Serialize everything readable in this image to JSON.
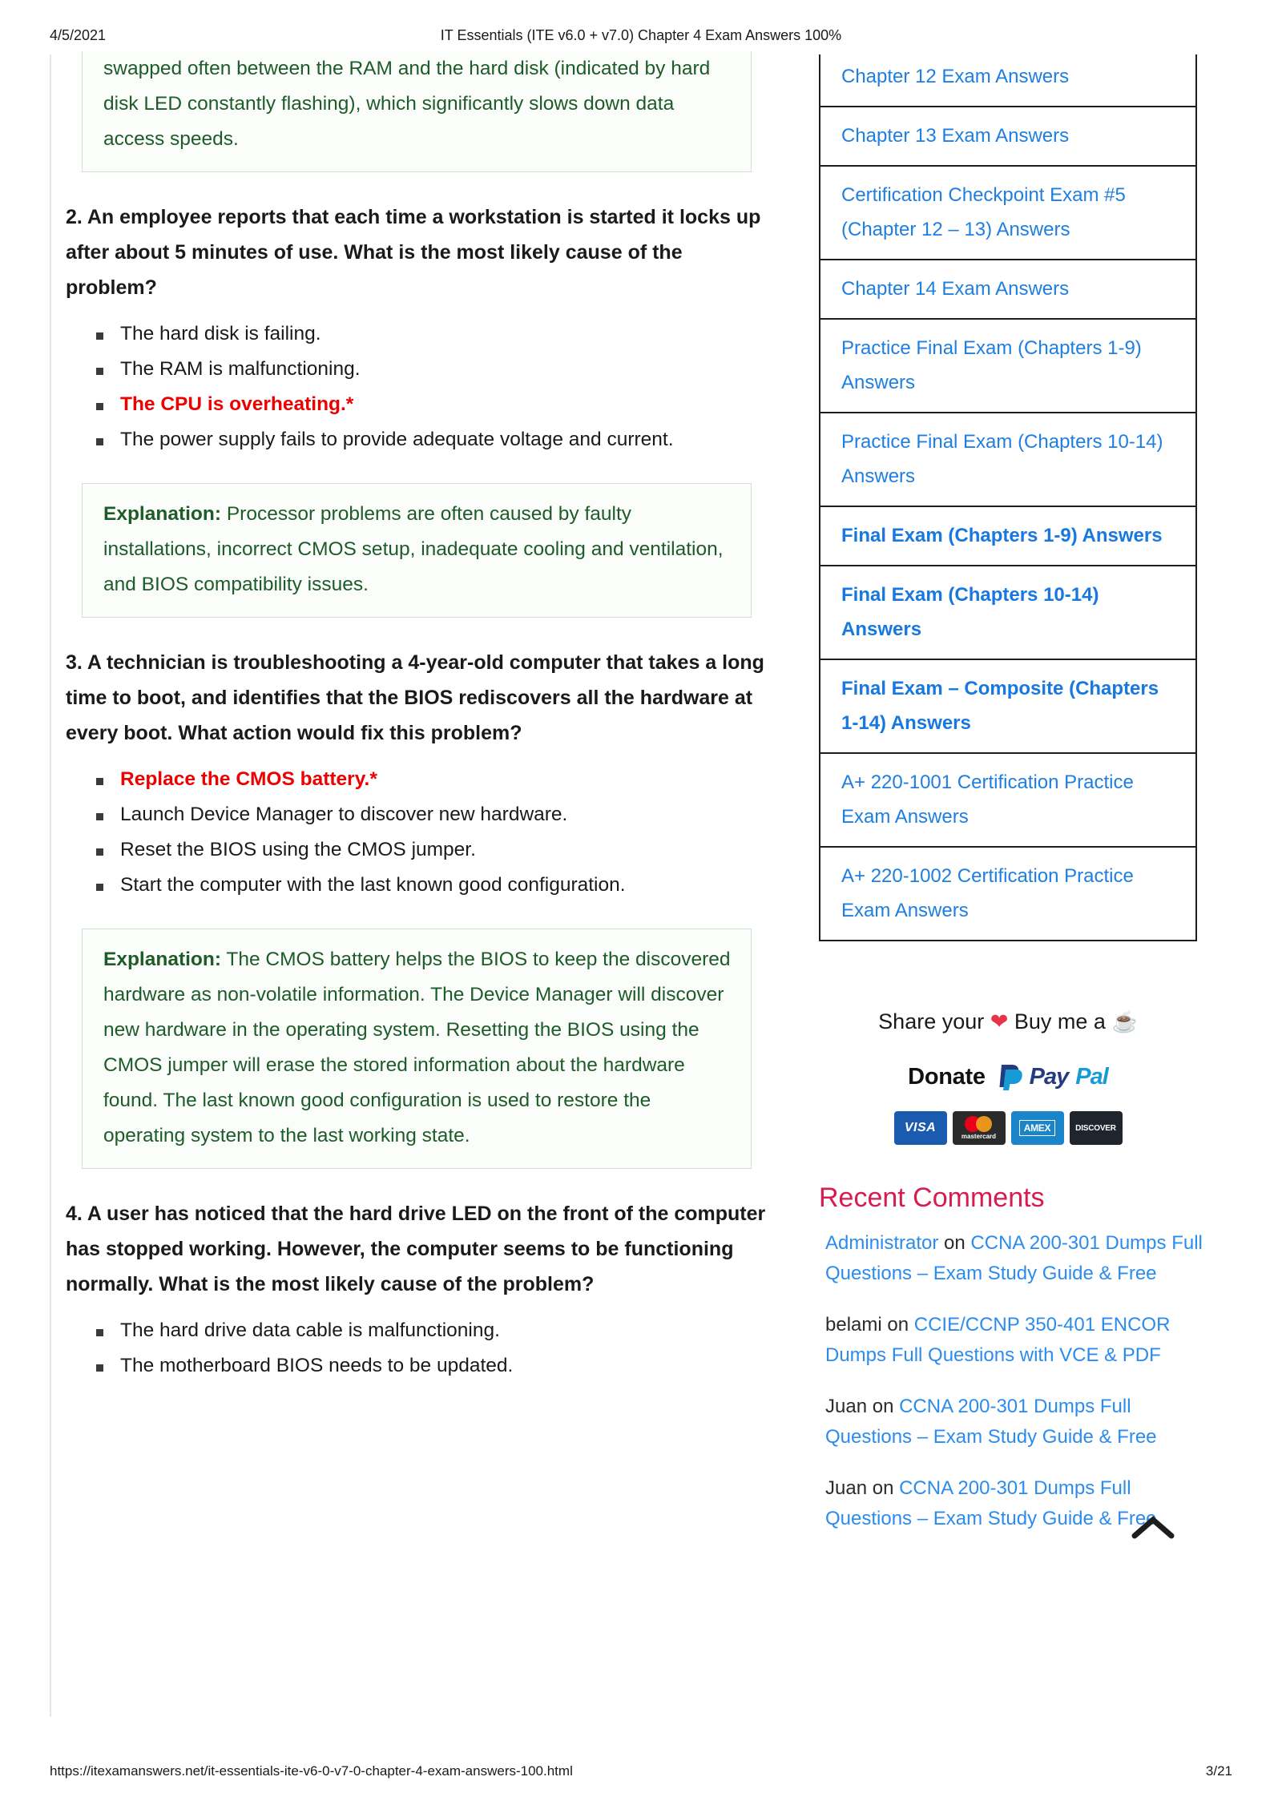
{
  "print": {
    "date": "4/5/2021",
    "title": "IT Essentials (ITE v6.0 + v7.0) Chapter 4 Exam Answers 100%",
    "url": "https://itexamanswers.net/it-essentials-ite-v6-0-v7-0-chapter-4-exam-answers-100.html",
    "page": "3/21"
  },
  "colors": {
    "link": "#2b8ced",
    "correct": "#ee0000",
    "explanation": "#1d5c28",
    "heading_pink": "#d81b50"
  },
  "article": {
    "explanation_top": {
      "text": "swapped often between the RAM and the hard disk (indicated by hard disk LED constantly flashing), which significantly slows down data access speeds."
    },
    "questions": [
      {
        "number": "2",
        "text": "2. An employee reports that each time a workstation is started it locks up after about 5 minutes of use. What is the most likely cause of the problem?",
        "choices": [
          "The hard disk is failing.",
          "The RAM is malfunctioning.",
          "The CPU is overheating.*",
          "The power supply fails to provide adequate voltage and current."
        ],
        "correct_index": 2,
        "explanation_label": "Explanation:",
        "explanation_text": " Processor problems are often caused by faulty installations, incorrect CMOS setup, inadequate cooling and ventilation, and BIOS compatibility issues."
      },
      {
        "number": "3",
        "text": "3. A technician is troubleshooting a 4-year-old computer that takes a long time to boot, and identifies that the BIOS rediscovers all the hardware at every boot. What action would fix this problem?",
        "choices": [
          "Replace the CMOS battery.*",
          "Launch Device Manager to discover new hardware.",
          "Reset the BIOS using the CMOS jumper.",
          "Start the computer with the last known good configuration."
        ],
        "correct_index": 0,
        "explanation_label": "Explanation:",
        "explanation_text": " The CMOS battery helps the BIOS to keep the discovered hardware as non-volatile information. The Device Manager will discover new hardware in the operating system. Resetting the BIOS using the CMOS jumper will erase the stored information about the hardware found. The last known good configuration is used to restore the operating system to the last working state."
      },
      {
        "number": "4",
        "text": "4. A user has noticed that the hard drive LED on the front of the computer has stopped working. However, the computer seems to be functioning normally. What is the most likely cause of the problem?",
        "choices": [
          "The hard drive data cable is malfunctioning.",
          "The motherboard BIOS needs to be updated."
        ],
        "correct_index": -1
      }
    ]
  },
  "sidebar": {
    "menu_items": [
      {
        "label": "Chapter 12 Exam Answers",
        "bold": false
      },
      {
        "label": "Chapter 13 Exam Answers",
        "bold": false
      },
      {
        "label": "Certification Checkpoint Exam #5 (Chapter 12 – 13) Answers",
        "bold": false
      },
      {
        "label": "Chapter 14 Exam Answers",
        "bold": false
      },
      {
        "label": "Practice Final Exam (Chapters 1-9) Answers",
        "bold": false
      },
      {
        "label": "Practice Final Exam (Chapters 10-14) Answers",
        "bold": false
      },
      {
        "label": "Final Exam (Chapters 1-9) Answers",
        "bold": true
      },
      {
        "label": "Final Exam (Chapters 10-14) Answers",
        "bold": true
      },
      {
        "label": "Final Exam – Composite (Chapters 1-14) Answers",
        "bold": true
      },
      {
        "label": "A+ 220-1001 Certification Practice Exam Answers",
        "bold": false
      },
      {
        "label": "A+ 220-1002 Certification Practice Exam Answers",
        "bold": false
      }
    ],
    "donate": {
      "share_prefix": "Share your ",
      "heart": "❤",
      "share_middle": " Buy me a ",
      "coffee": "☕",
      "donate_label": "Donate",
      "paypal_pay": "Pay",
      "paypal_pal": "Pal",
      "cards": [
        {
          "name": "visa",
          "label": "VISA"
        },
        {
          "name": "mastercard",
          "label": "mastercard"
        },
        {
          "name": "amex",
          "label": "AMEX"
        },
        {
          "name": "discover",
          "label": "DISCOVER"
        }
      ]
    },
    "recent_comments": {
      "title": "Recent Comments",
      "items": [
        {
          "author": "Administrator",
          "author_is_link": true,
          "on": " on ",
          "post": "CCNA 200-301 Dumps Full Questions – Exam Study Guide & Free"
        },
        {
          "author": "belami",
          "author_is_link": false,
          "on": " on ",
          "post": "CCIE/CCNP 350-401 ENCOR Dumps Full Questions with VCE & PDF"
        },
        {
          "author": "Juan",
          "author_is_link": false,
          "on": " on ",
          "post": "CCNA 200-301 Dumps Full Questions – Exam Study Guide & Free"
        },
        {
          "author": "Juan",
          "author_is_link": false,
          "on": " on ",
          "post": "CCNA 200-301 Dumps Full Questions – Exam Study Guide & Free"
        }
      ]
    },
    "back_to_top_icon": "chevron-up-icon"
  }
}
